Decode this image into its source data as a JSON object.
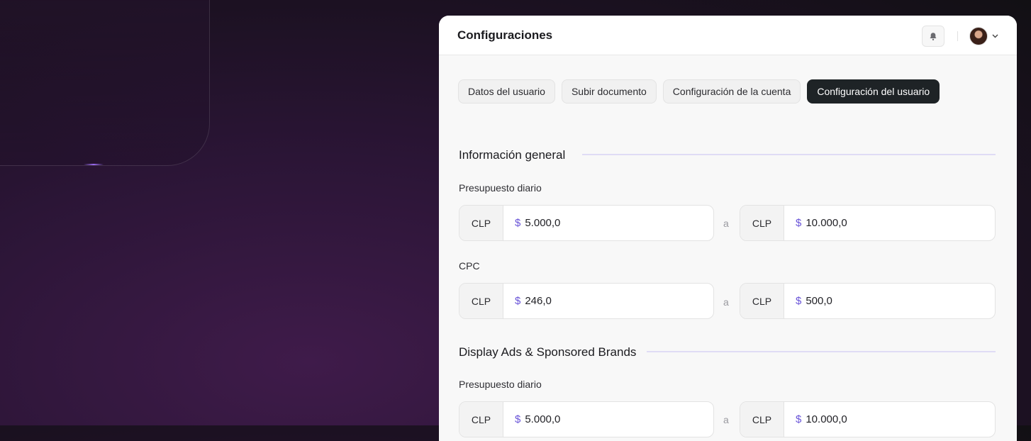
{
  "header": {
    "title": "Configuraciones"
  },
  "tabs": [
    {
      "label": "Datos del usuario",
      "active": false
    },
    {
      "label": "Subir documento",
      "active": false
    },
    {
      "label": "Configuración de la cuenta",
      "active": false
    },
    {
      "label": "Configuración del usuario",
      "active": true
    }
  ],
  "sections": [
    {
      "title": "Información general",
      "fields": [
        {
          "label": "Presupuesto diario",
          "currency": "CLP",
          "symbol": "$",
          "min": "5.000,0",
          "separator": "a",
          "max": "10.000,0"
        },
        {
          "label": "CPC",
          "currency": "CLP",
          "symbol": "$",
          "min": "246,0",
          "separator": "a",
          "max": "500,0"
        }
      ]
    },
    {
      "title": "Display Ads & Sponsored Brands",
      "fields": [
        {
          "label": "Presupuesto diario",
          "currency": "CLP",
          "symbol": "$",
          "min": "5.000,0",
          "separator": "a",
          "max": "10.000,0"
        }
      ]
    }
  ],
  "colors": {
    "accent": "#6a55d8",
    "active_tab": "#1e2326",
    "section_line": "#e0dcf5"
  },
  "icons": {
    "notifications": "bell-icon",
    "avatar": "user-avatar",
    "menu": "chevron-down-icon"
  }
}
